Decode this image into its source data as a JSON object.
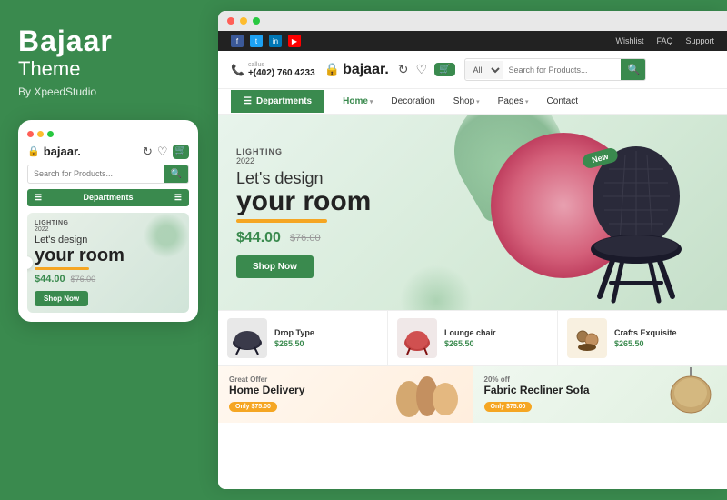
{
  "brand": {
    "name": "Bajaar",
    "subtitle": "Theme",
    "by": "By XpeedStudio"
  },
  "mobile": {
    "dots": [
      "red",
      "yellow",
      "green"
    ],
    "logo": "bajaar.",
    "search_placeholder": "Search for Products...",
    "departments": "Departments",
    "banner": {
      "tag": "LIGHTING",
      "year": "2022",
      "h1": "Let's design",
      "h2": "your room",
      "price_main": "$44.00",
      "price_old": "$76.00",
      "shop_btn": "Shop Now"
    }
  },
  "browser": {
    "topbar": {
      "links": [
        "Wishlist",
        "FAQ",
        "Support"
      ]
    },
    "header": {
      "phone_label": "callus",
      "phone_number": "+(402) 760 4233",
      "logo": "bajaar.",
      "search_placeholder": "Search for Products...",
      "search_category": "All"
    },
    "nav": {
      "departments": "Departments",
      "links": [
        "Home",
        "Decoration",
        "Shop",
        "Pages",
        "Contact"
      ]
    },
    "hero": {
      "tag": "LIGHTING",
      "year": "2022",
      "h1": "Let's design",
      "h2": "your room",
      "price_main": "$44.00",
      "price_old": "$76.00",
      "shop_btn": "Shop Now",
      "new_badge": "New"
    },
    "products": [
      {
        "name": "Drop Type",
        "price": "$265.50"
      },
      {
        "name": "Lounge chair",
        "price": "$265.50"
      },
      {
        "name": "Crafts Exquisite",
        "price": "$265.50"
      }
    ],
    "promos": [
      {
        "label": "Great Offer",
        "title": "Home Delivery",
        "badge": "Only $75.00"
      },
      {
        "label": "20% off",
        "title": "Fabric Recliner Sofa",
        "badge": "Only $75.00"
      }
    ]
  },
  "colors": {
    "green": "#3a8a4e",
    "orange": "#f5a623",
    "dark": "#222222"
  }
}
